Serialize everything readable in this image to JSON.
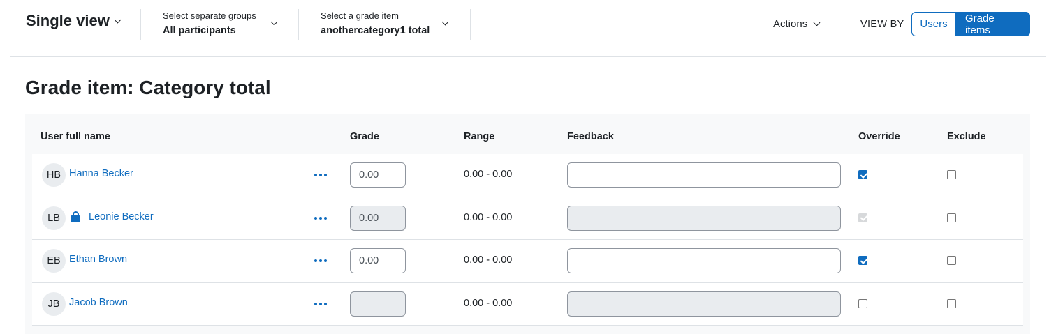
{
  "nav": {
    "view_selector": "Single view",
    "groups": {
      "title": "Select separate groups",
      "value": "All participants"
    },
    "grade_item": {
      "title": "Select a grade item",
      "value": "anothercategory1 total"
    },
    "actions": "Actions",
    "view_by": {
      "label": "VIEW BY",
      "options": [
        "Users",
        "Grade items"
      ],
      "active": "Grade items"
    }
  },
  "page_title": "Grade item: Category total",
  "table": {
    "columns": [
      "User full name",
      "Grade",
      "Range",
      "Feedback",
      "Override",
      "Exclude"
    ],
    "rows": [
      {
        "initials": "HB",
        "name": "Hanna Becker",
        "locked": false,
        "grade": "0.00",
        "grade_disabled": false,
        "range": "0.00 - 0.00",
        "feedback": "",
        "feedback_disabled": false,
        "override": true,
        "override_disabled": false,
        "exclude": false
      },
      {
        "initials": "LB",
        "name": "Leonie Becker",
        "locked": true,
        "grade": "0.00",
        "grade_disabled": true,
        "range": "0.00 - 0.00",
        "feedback": "",
        "feedback_disabled": true,
        "override": true,
        "override_disabled": true,
        "exclude": false
      },
      {
        "initials": "EB",
        "name": "Ethan Brown",
        "locked": false,
        "grade": "0.00",
        "grade_disabled": false,
        "range": "0.00 - 0.00",
        "feedback": "",
        "feedback_disabled": false,
        "override": true,
        "override_disabled": false,
        "exclude": false
      },
      {
        "initials": "JB",
        "name": "Jacob Brown",
        "locked": false,
        "grade": "",
        "grade_disabled": true,
        "range": "0.00 - 0.00",
        "feedback": "",
        "feedback_disabled": true,
        "override": false,
        "override_disabled": false,
        "exclude": false
      }
    ]
  },
  "colors": {
    "primary": "#0f6cbf",
    "disabled_bg": "#e9ecef",
    "table_bg": "#f8f9fa"
  }
}
